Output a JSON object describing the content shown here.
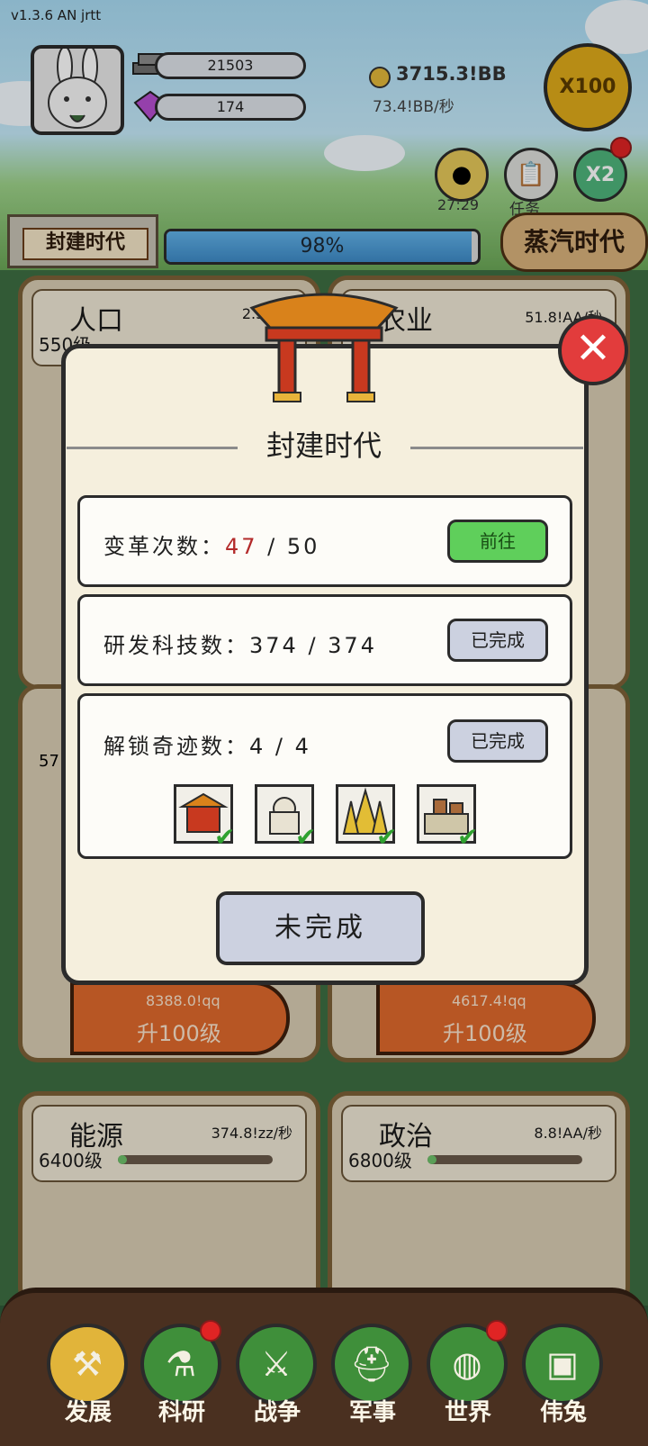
{
  "header": {
    "version": "v1.3.6 AN jrtt",
    "steel": "21503",
    "gems": "174",
    "gold_total": "3715.3!BB",
    "gold_rate": "73.4!BB/秒",
    "multiplier_button": "X100",
    "coin_timer": "27:29",
    "task_label": "任务",
    "x2_label": "X2"
  },
  "era": {
    "current": "封建时代",
    "progress_text": "98%",
    "progress_value": 0.98,
    "next": "蒸汽时代"
  },
  "background_cards": {
    "population": {
      "title": "人口",
      "rate": "2.5!xx/",
      "level": "550级"
    },
    "agriculture": {
      "title": "农业",
      "rate": "51.8!AA/秒"
    },
    "card3_level": "57",
    "upgrade_left": {
      "price": "8388.0!qq",
      "label": "升100级"
    },
    "upgrade_right": {
      "price": "4617.4!qq",
      "label": "升100级"
    },
    "energy": {
      "title": "能源",
      "rate": "374.8!zz/秒",
      "level": "6400级"
    },
    "politics": {
      "title": "政治",
      "rate": "8.8!AA/秒",
      "level": "6800级"
    }
  },
  "modal": {
    "title": "封建时代",
    "rows": [
      {
        "label": "变革次数：",
        "current": "47",
        "sep": " / ",
        "total": "50",
        "button": "前往"
      },
      {
        "label": "研发科技数：",
        "value": "374 / 374",
        "button": "已完成"
      },
      {
        "label": "解锁奇迹数：",
        "value": "4 / 4",
        "button": "已完成"
      }
    ],
    "footer_button": "未完成",
    "close_icon": "close-icon",
    "wonders": [
      "palace-icon",
      "taj-mahal-icon",
      "golden-pagoda-icon",
      "great-wall-icon"
    ]
  },
  "nav": [
    {
      "label": "发展",
      "icon": "hammer-icon"
    },
    {
      "label": "科研",
      "icon": "flask-icon"
    },
    {
      "label": "战争",
      "icon": "crossed-swords-icon"
    },
    {
      "label": "军事",
      "icon": "helmet-icon"
    },
    {
      "label": "世界",
      "icon": "globe-icon"
    },
    {
      "label": "伟兔",
      "icon": "portrait-icon"
    }
  ]
}
